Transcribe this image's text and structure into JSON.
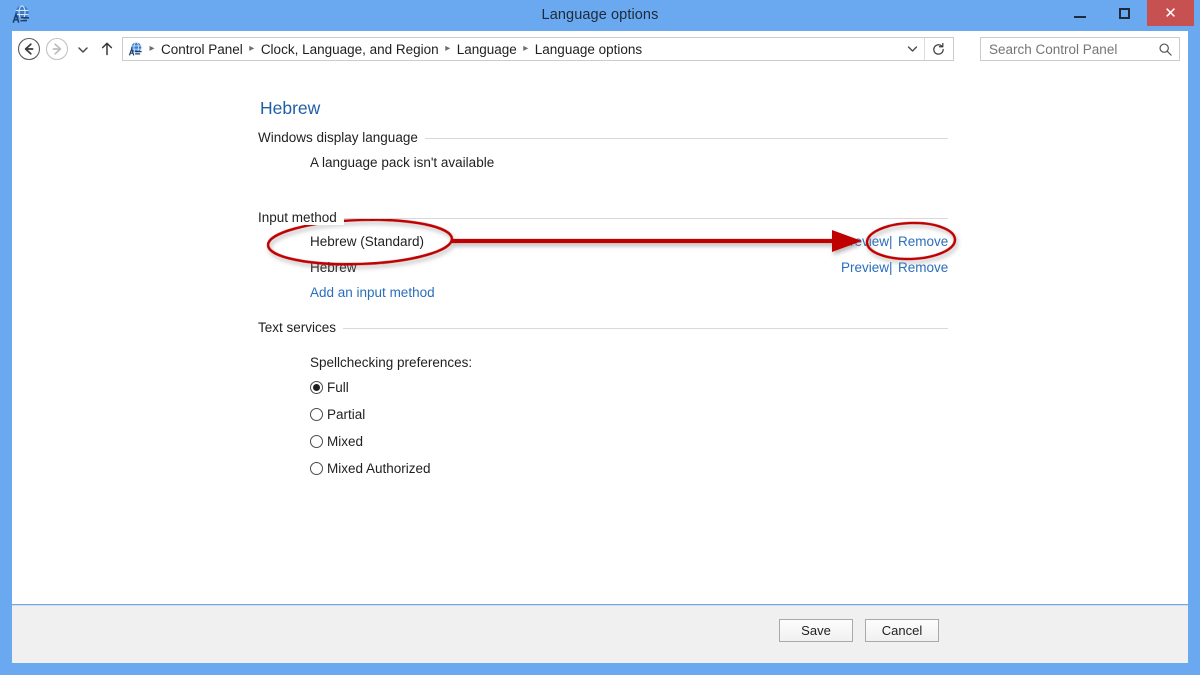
{
  "window": {
    "title": "Language options",
    "icon": "language-globe-icon",
    "controls": {
      "minimize": "Minimize",
      "maximize": "Maximize",
      "close": "Close",
      "close_glyph": "✕",
      "accent": "#6aa8f0",
      "close_color": "#c75050"
    }
  },
  "nav": {
    "back": "Back",
    "forward": "Forward",
    "recent_pages": "Recent pages",
    "up": "Up one level",
    "breadcrumb": [
      "Control Panel",
      "Clock, Language, and Region",
      "Language",
      "Language options"
    ],
    "breadcrumb_separator": "▸",
    "address_chevron": "Previous locations",
    "refresh": "Refresh"
  },
  "search": {
    "placeholder": "Search Control Panel",
    "value": "",
    "icon": "search-icon"
  },
  "main": {
    "page_title": "Hebrew",
    "sections": [
      {
        "label": "Windows display language",
        "note": "A language pack isn't available"
      },
      {
        "label": "Input method",
        "rows": [
          {
            "name": "Hebrew (Standard)",
            "preview": "Preview",
            "separator": "|",
            "remove": "Remove"
          },
          {
            "name": "Hebrew",
            "preview": "Preview",
            "separator": "|",
            "remove": "Remove"
          }
        ],
        "add_link": "Add an input method"
      },
      {
        "label": "Text services",
        "subtitle": "Spellchecking preferences:",
        "options": [
          {
            "label": "Full",
            "selected": true
          },
          {
            "label": "Partial",
            "selected": false
          },
          {
            "label": "Mixed",
            "selected": false
          },
          {
            "label": "Mixed Authorized",
            "selected": false
          }
        ]
      }
    ]
  },
  "footer": {
    "save": "Save",
    "cancel": "Cancel"
  },
  "annotations": {
    "color": "#c00000",
    "ellipse_input_method": "Hebrew (Standard)",
    "ellipse_remove": "Remove",
    "arrow_from": "Hebrew (Standard)",
    "arrow_to": "Preview"
  }
}
